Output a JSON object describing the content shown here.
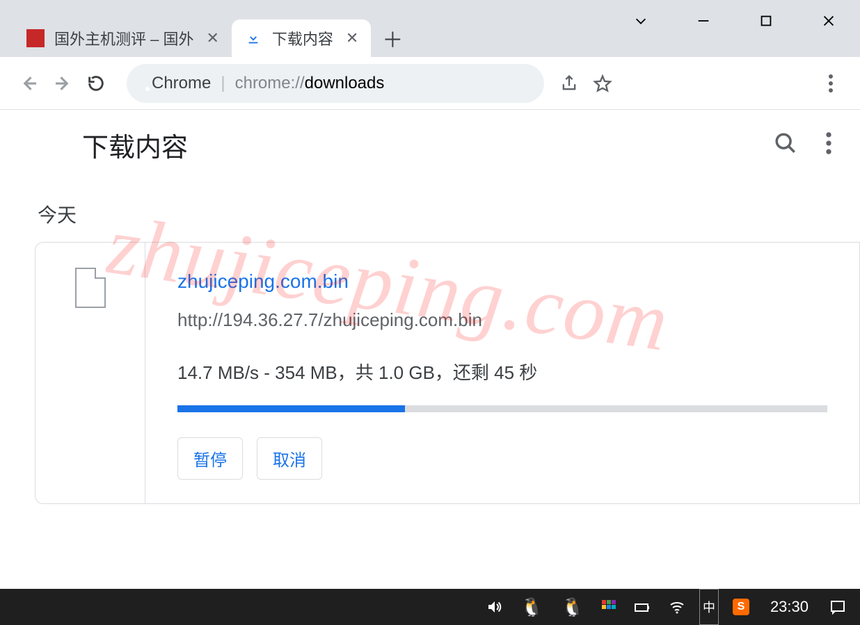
{
  "window": {
    "tabs": [
      {
        "title": "国外主机测评 – 国外"
      },
      {
        "title": "下载内容"
      }
    ]
  },
  "omnibox": {
    "label": "Chrome",
    "url_prefix": "chrome://",
    "url_path": "downloads"
  },
  "page": {
    "title": "下载内容",
    "date_label": "今天"
  },
  "download": {
    "filename": "zhujiceping.com.bin",
    "url": "http://194.36.27.7/zhujiceping.com.bin",
    "progress_text": "14.7 MB/s - 354 MB，共 1.0 GB，还剩 45 秒",
    "progress_percent": 35,
    "pause_label": "暂停",
    "cancel_label": "取消"
  },
  "watermark": "zhujiceping.com",
  "taskbar": {
    "ime": "中",
    "clock": "23:30",
    "sogou": "S"
  }
}
